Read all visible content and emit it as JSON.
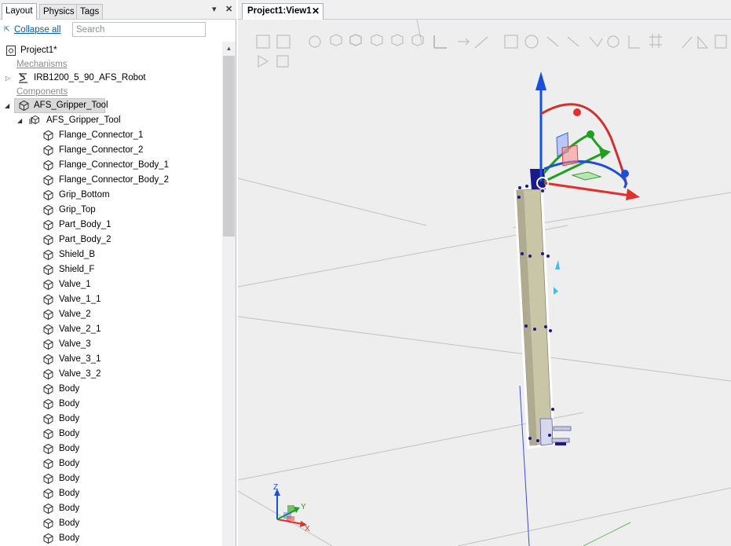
{
  "left_panel": {
    "tabs": [
      "Layout",
      "Physics",
      "Tags"
    ],
    "collapse_all": "Collapse all",
    "search_placeholder": "Search",
    "tree": {
      "project": "Project1*",
      "mechanisms_header": "Mechanisms",
      "robot": "IRB1200_5_90_AFS_Robot",
      "components_header": "Components",
      "component": "AFS_Gripper_Tool",
      "component_child": "AFS_Gripper_Tool",
      "parts": [
        "Flange_Connector_1",
        "Flange_Connector_2",
        "Flange_Connector_Body_1",
        "Flange_Connector_Body_2",
        "Grip_Bottom",
        "Grip_Top",
        "Part_Body_1",
        "Part_Body_2",
        "Shield_B",
        "Shield_F",
        "Valve_1",
        "Valve_1_1",
        "Valve_2",
        "Valve_2_1",
        "Valve_3",
        "Valve_3_1",
        "Valve_3_2",
        "Body",
        "Body",
        "Body",
        "Body",
        "Body",
        "Body",
        "Body",
        "Body",
        "Body",
        "Body",
        "Body"
      ]
    }
  },
  "document": {
    "tab_label": "Project1:View1"
  },
  "viewport": {
    "axis_labels": {
      "x": "X",
      "y": "Y",
      "z": "Z"
    },
    "colors": {
      "background": "#eeeeee",
      "x_axis": "#e03030",
      "y_axis": "#20a020",
      "z_axis": "#1a4fd6",
      "tool_body": "#c9c6a8",
      "bolt": "#1a1a8a"
    }
  }
}
